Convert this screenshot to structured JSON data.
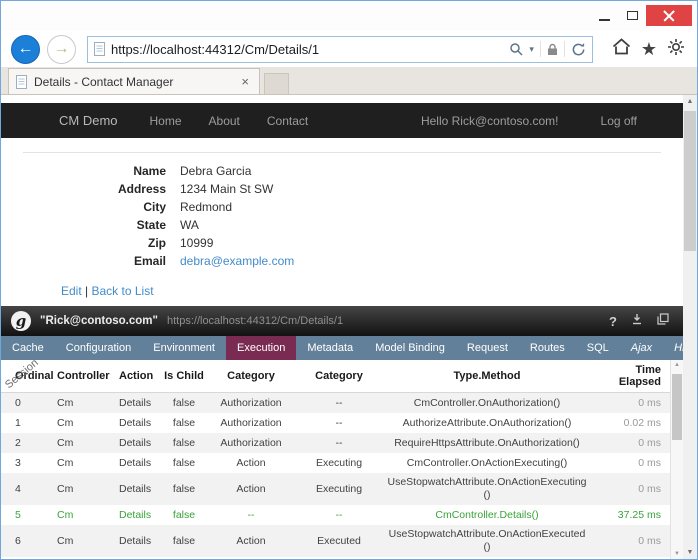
{
  "colors": {
    "link_accent": "#428bca",
    "navbar_bg": "#1f1f1f",
    "glimpse_tab_bar": "#628099",
    "glimpse_tab_active": "#7a2b52",
    "highlight_green": "#3aa23a",
    "close_button_red": "#e04343"
  },
  "browser": {
    "url": "https://localhost:44312/Cm/Details/1",
    "tab": {
      "title": "Details - Contact Manager"
    }
  },
  "site": {
    "navbar": {
      "brand": "CM Demo",
      "links": [
        "Home",
        "About",
        "Contact"
      ],
      "greeting": "Hello Rick@contoso.com!",
      "logoff": "Log off"
    },
    "details": {
      "fields": [
        {
          "label": "Name",
          "value": "Debra Garcia"
        },
        {
          "label": "Address",
          "value": "1234 Main St SW"
        },
        {
          "label": "City",
          "value": "Redmond"
        },
        {
          "label": "State",
          "value": "WA"
        },
        {
          "label": "Zip",
          "value": "10999"
        },
        {
          "label": "Email",
          "value": "debra@example.com"
        }
      ],
      "actions": {
        "edit": "Edit",
        "separator": "|",
        "back": "Back to List"
      }
    }
  },
  "glimpse": {
    "user": "\"Rick@contoso.com\"",
    "url": "https://localhost:44312/Cm/Details/1",
    "help_glyph": "?",
    "session_label": "Session",
    "active_tab": "Execution",
    "tabs": [
      "Cache",
      "Configuration",
      "Environment",
      "Execution",
      "Metadata",
      "Model Binding",
      "Request",
      "Routes",
      "SQL",
      "Ajax",
      "History"
    ],
    "table": {
      "headers": [
        "Ordinal",
        "Controller",
        "Action",
        "Is Child",
        "Category",
        "Category",
        "Type.Method",
        "Time Elapsed"
      ],
      "rows": [
        {
          "cells": [
            "0",
            "Cm",
            "Details",
            "false",
            "Authorization",
            "--",
            "CmController.OnAuthorization()",
            "0 ms"
          ],
          "highlight": false
        },
        {
          "cells": [
            "1",
            "Cm",
            "Details",
            "false",
            "Authorization",
            "--",
            "AuthorizeAttribute.OnAuthorization()",
            "0.02 ms"
          ],
          "highlight": false
        },
        {
          "cells": [
            "2",
            "Cm",
            "Details",
            "false",
            "Authorization",
            "--",
            "RequireHttpsAttribute.OnAuthorization()",
            "0 ms"
          ],
          "highlight": false
        },
        {
          "cells": [
            "3",
            "Cm",
            "Details",
            "false",
            "Action",
            "Executing",
            "CmController.OnActionExecuting()",
            "0 ms"
          ],
          "highlight": false
        },
        {
          "cells": [
            "4",
            "Cm",
            "Details",
            "false",
            "Action",
            "Executing",
            "UseStopwatchAttribute.OnActionExecuting()",
            "0 ms"
          ],
          "highlight": false
        },
        {
          "cells": [
            "5",
            "Cm",
            "Details",
            "false",
            "--",
            "--",
            "CmController.Details()",
            "37.25 ms"
          ],
          "highlight": true
        },
        {
          "cells": [
            "6",
            "Cm",
            "Details",
            "false",
            "Action",
            "Executed",
            "UseStopwatchAttribute.OnActionExecuted()",
            "0 ms"
          ],
          "highlight": false
        }
      ]
    }
  }
}
